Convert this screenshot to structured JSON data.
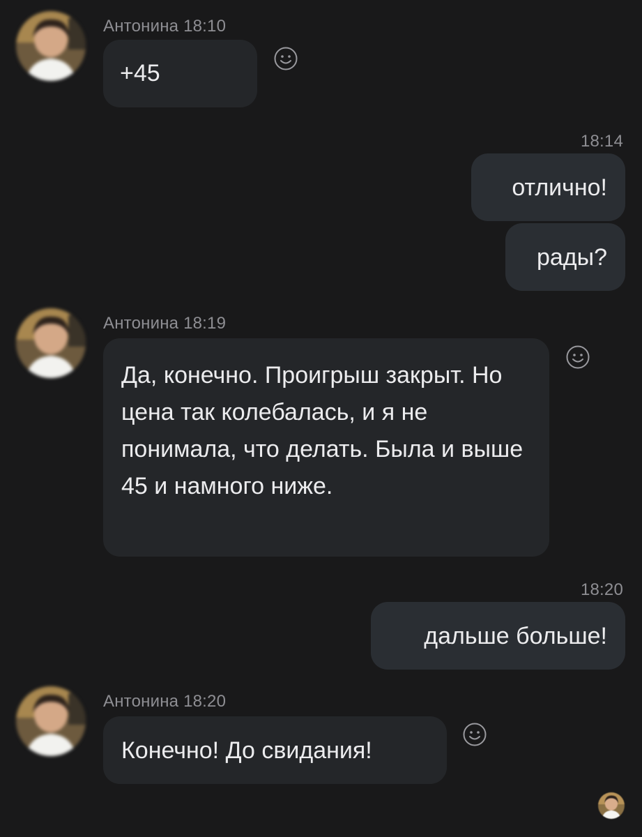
{
  "messages": [
    {
      "id": "m1",
      "direction": "incoming",
      "sender": "Антонина",
      "time": "18:10",
      "text": "+45"
    },
    {
      "id": "m2",
      "direction": "outgoing",
      "time": "18:14",
      "text": "отлично!"
    },
    {
      "id": "m3",
      "direction": "outgoing",
      "text": "рады?"
    },
    {
      "id": "m4",
      "direction": "incoming",
      "sender": "Антонина",
      "time": "18:19",
      "text": "Да, конечно. Проигрыш закрыт. Но цена так колебалась, и я не понимала, что делать. Была и выше 45 и намного ниже."
    },
    {
      "id": "m5",
      "direction": "outgoing",
      "time": "18:20",
      "text": "дальше больше!"
    },
    {
      "id": "m6",
      "direction": "incoming",
      "sender": "Антонина",
      "time": "18:20",
      "text": "Конечно! До свидания!"
    }
  ],
  "icons": {
    "reaction": "smiley-face-icon",
    "avatar": "contact-avatar",
    "read_receipt": "read-receipt-avatar"
  },
  "colors": {
    "background": "#19191a",
    "incoming_bubble": "#242629",
    "outgoing_bubble": "#2a2e33",
    "message_text": "#ececee",
    "meta_text": "#8e8e93"
  }
}
